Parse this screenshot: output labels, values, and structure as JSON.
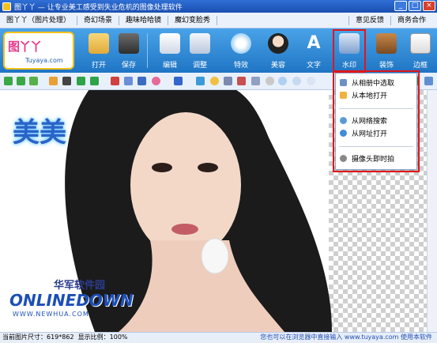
{
  "window": {
    "title": "图丫丫 — 让专业美工感受到失业危机的图像处理软件",
    "controls": [
      "_",
      "□",
      "×"
    ]
  },
  "menu": {
    "left": [
      "图丫丫（图片处理）",
      "奇幻场景",
      "趣味哈哈镜",
      "魔幻变脸秀"
    ],
    "right": [
      "意见反馈",
      "商务合作"
    ]
  },
  "logo": {
    "text1": "图丫丫",
    "text2": "Tuyaya.com"
  },
  "toolbar": {
    "open": "打开",
    "save": "保存",
    "edit": "编辑",
    "adjust": "调整",
    "effects": "特效",
    "beauty": "美容",
    "text": "文字",
    "watermark": "水印",
    "decorate": "装饰",
    "border": "边框"
  },
  "dropdown": {
    "from_album": "从相册中选取",
    "from_local": "从本地打开",
    "web_search": "从网络搜索",
    "from_url": "从网址打开",
    "camera": "摄像头即时拍"
  },
  "canvas": {
    "watermark_text": "美美",
    "site_cn": "华军软件园",
    "site_en": "ONLINEDOWN",
    "site_url": "WWW.NEWHUA.COM"
  },
  "status": {
    "image_size": "当前图片尺寸：619*862",
    "zoom": "显示比例：100%",
    "right_text": "您也可以在浏览器中直接输入 www.tuyaya.com 使用本软件"
  },
  "colors": {
    "toolbar_blue": "#2f86d6",
    "highlight_red": "#e0161b",
    "title_blue": "#1a4fb0"
  }
}
